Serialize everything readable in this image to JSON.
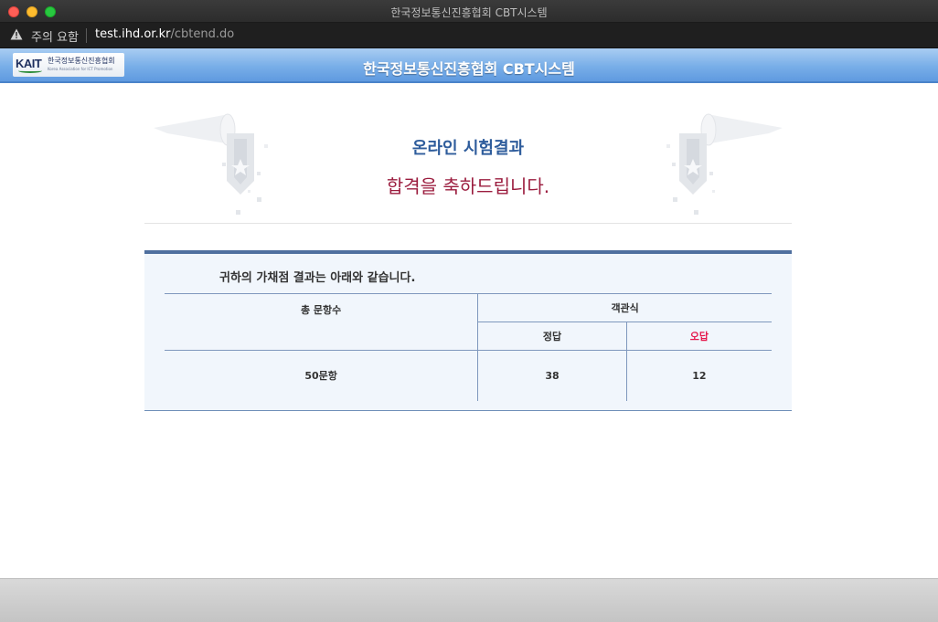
{
  "window": {
    "title": "한국정보통신진흥협회 CBT시스템"
  },
  "addressbar": {
    "warning_text": "주의 요함",
    "url_host": "test.ihd.or.kr",
    "url_path": "/cbtend.do"
  },
  "header": {
    "logo": {
      "mark": "KAIT",
      "org_ko": "한국정보통신진흥협회",
      "org_en": "Korea Association for ICT Promotion"
    },
    "site_title": "한국정보통신진흥협회 CBT시스템"
  },
  "hero": {
    "title": "온라인 시험결과",
    "message": "합격을 축하드립니다."
  },
  "result": {
    "description": "귀하의 가채점 결과는 아래와 같습니다.",
    "headers": {
      "total_questions": "총 문항수",
      "objective": "객관식",
      "correct": "정답",
      "wrong": "오답"
    },
    "values": {
      "total_questions": "50문항",
      "correct": "38",
      "wrong": "12"
    }
  },
  "colors": {
    "header_blue": "#78aee8",
    "title_blue": "#2f5d9c",
    "congrats_red": "#9b1c3e",
    "wrong_red": "#e5184c"
  }
}
